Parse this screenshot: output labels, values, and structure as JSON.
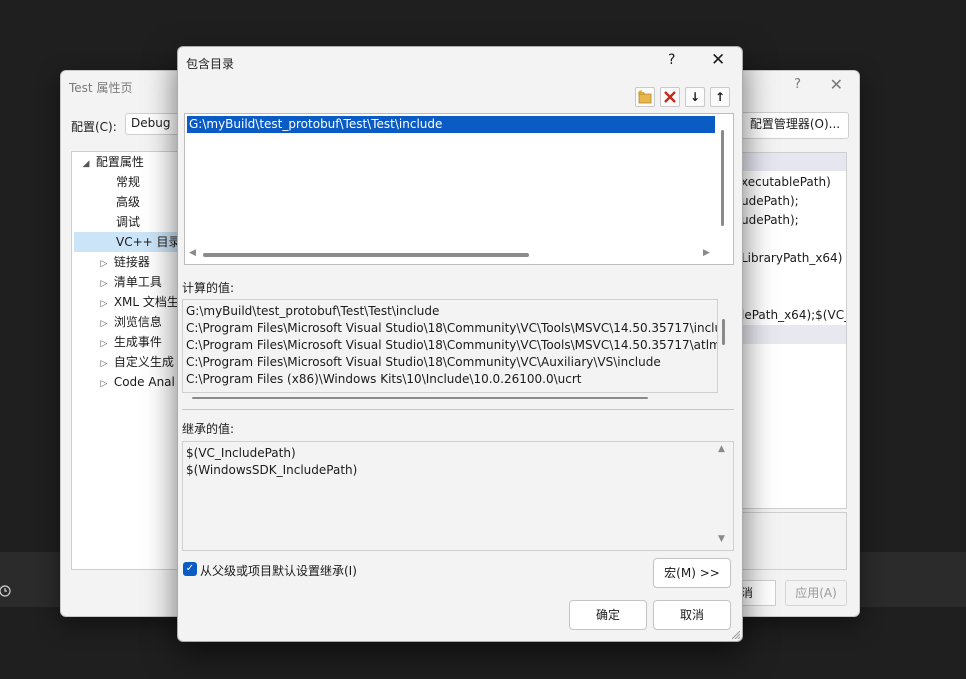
{
  "back_dialog": {
    "title": "Test 属性页",
    "help": "?",
    "close": "✕",
    "config_label": "配置(C):",
    "config_value": "Debug",
    "config_manager": "配置管理器(O)...",
    "tree": [
      {
        "label": "配置属性",
        "expanded": true,
        "level": 0
      },
      {
        "label": "常规",
        "level": 1
      },
      {
        "label": "高级",
        "level": 1
      },
      {
        "label": "调试",
        "level": 1
      },
      {
        "label": "VC++ 目录",
        "level": 1,
        "selected": true
      },
      {
        "label": "链接器",
        "level": 1,
        "collapsed": true
      },
      {
        "label": "清单工具",
        "level": 1,
        "collapsed": true
      },
      {
        "label": "XML 文档生",
        "level": 1,
        "collapsed": true
      },
      {
        "label": "浏览信息",
        "level": 1,
        "collapsed": true
      },
      {
        "label": "生成事件",
        "level": 1,
        "collapsed": true
      },
      {
        "label": "自定义生成",
        "level": 1,
        "collapsed": true
      },
      {
        "label": "Code Anal",
        "level": 1,
        "collapsed": true
      }
    ],
    "grid_rows": [
      "xecutablePath)",
      "udePath);",
      "udePath);",
      "",
      "LibraryPath_x64)",
      "",
      "lePath_x64);$(VC_I"
    ],
    "cancel_fragment": "消",
    "apply": "应用(A)"
  },
  "dialog": {
    "title": "包含目录",
    "help": "?",
    "close": "✕",
    "toolbar": {
      "new_line": "new-folder-icon",
      "delete": "delete-icon",
      "move_down": "↓",
      "move_up": "↑"
    },
    "entries": [
      "G:\\myBuild\\test_protobuf\\Test\\Test\\include"
    ],
    "evaluated_label": "计算的值:",
    "evaluated_values": [
      "G:\\myBuild\\test_protobuf\\Test\\Test\\include",
      "C:\\Program Files\\Microsoft Visual Studio\\18\\Community\\VC\\Tools\\MSVC\\14.50.35717\\inclu",
      "C:\\Program Files\\Microsoft Visual Studio\\18\\Community\\VC\\Tools\\MSVC\\14.50.35717\\atlm",
      "C:\\Program Files\\Microsoft Visual Studio\\18\\Community\\VC\\Auxiliary\\VS\\include",
      "C:\\Program Files (x86)\\Windows Kits\\10\\Include\\10.0.26100.0\\ucrt"
    ],
    "inherited_label": "继承的值:",
    "inherited_values": [
      "$(VC_IncludePath)",
      "$(WindowsSDK_IncludePath)"
    ],
    "inherit_checkbox_label": "从父级或项目默认设置继承(I)",
    "inherit_checked": true,
    "macros_button": "宏(M) >>",
    "ok_button": "确定",
    "cancel_button": "取消"
  },
  "colors": {
    "accent": "#0a5bc4",
    "dialog_bg": "#f3f3f3",
    "background": "#1f1f1f"
  }
}
